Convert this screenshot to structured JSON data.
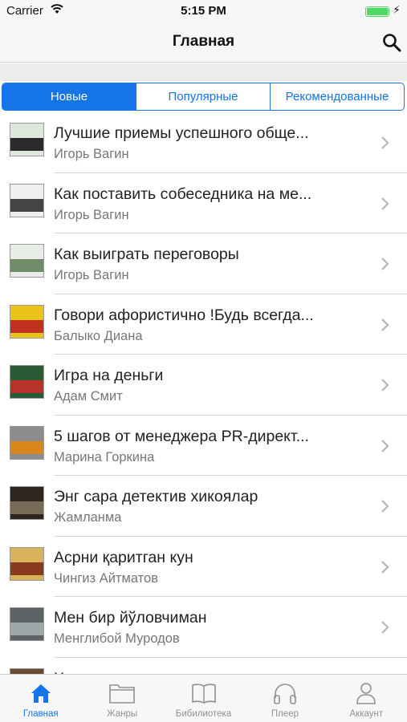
{
  "status": {
    "carrier": "Carrier",
    "time": "5:15 PM",
    "battery_level": 1.0
  },
  "nav": {
    "title": "Главная"
  },
  "segments": {
    "items": [
      "Новые",
      "Популярные",
      "Рекомендованные"
    ],
    "active_index": 0
  },
  "books": [
    {
      "title": "Лучшие приемы успешного обще...",
      "author": "Игорь Вагин",
      "cover_colors": [
        "#dfe8dd",
        "#2b2b2b"
      ]
    },
    {
      "title": "Как поставить собеседника на ме...",
      "author": "Игорь Вагин",
      "cover_colors": [
        "#efefef",
        "#444444"
      ]
    },
    {
      "title": "Как выиграть переговоры",
      "author": "Игорь Вагин",
      "cover_colors": [
        "#e7ede6",
        "#6f8c66"
      ]
    },
    {
      "title": "Говори афористично !Будь всегда...",
      "author": "Балыко Диана",
      "cover_colors": [
        "#e9c21a",
        "#c0311f"
      ]
    },
    {
      "title": "Игра на деньги",
      "author": "Адам Смит",
      "cover_colors": [
        "#2b5a36",
        "#b73329"
      ]
    },
    {
      "title": "5 шагов от менеджера PR-директ...",
      "author": "Марина Горкина",
      "cover_colors": [
        "#8c8c8c",
        "#d9861c"
      ]
    },
    {
      "title": "Энг сара детектив хикоялар",
      "author": "Жамланма",
      "cover_colors": [
        "#2e2620",
        "#7a6a58"
      ]
    },
    {
      "title": "Асрни қаритган кун",
      "author": "Чингиз Айтматов",
      "cover_colors": [
        "#d7b35c",
        "#8a3a1e"
      ]
    },
    {
      "title": "Мен бир йўловчиман",
      "author": "Менглибой Муродов",
      "cover_colors": [
        "#5e6466",
        "#9fa6a8"
      ]
    },
    {
      "title": "Х",
      "author": "",
      "cover_colors": [
        "#6b4a2f",
        "#a57548"
      ]
    }
  ],
  "tabs": {
    "items": [
      {
        "label": "Главная",
        "icon": "home-icon"
      },
      {
        "label": "Жанры",
        "icon": "folder-icon"
      },
      {
        "label": "Бибилиотека",
        "icon": "book-icon"
      },
      {
        "label": "Плеер",
        "icon": "headphones-icon"
      },
      {
        "label": "Аккаунт",
        "icon": "person-icon"
      }
    ],
    "active_index": 0
  },
  "colors": {
    "accent": "#1474e8",
    "tab_inactive": "#909090",
    "battery": "#4cd964"
  }
}
